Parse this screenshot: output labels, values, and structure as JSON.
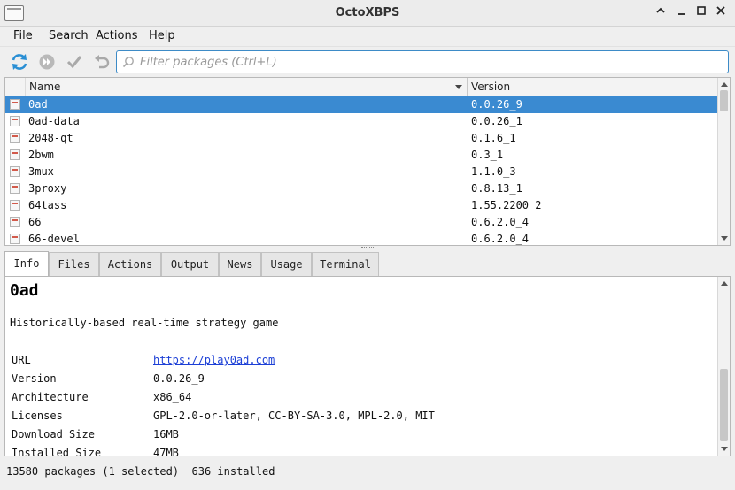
{
  "window": {
    "title": "OctoXBPS"
  },
  "menu": [
    {
      "label": "File"
    },
    {
      "label": "Search"
    },
    {
      "label": "Actions"
    },
    {
      "label": "Help"
    }
  ],
  "toolbar": {
    "icons": [
      "sync-icon",
      "run-icon",
      "commit-icon",
      "rollback-icon"
    ],
    "search_placeholder": "Filter packages (Ctrl+L)"
  },
  "table": {
    "columns": {
      "name": "Name",
      "version": "Version"
    },
    "rows": [
      {
        "name": "0ad",
        "version": "0.0.26_9",
        "selected": true
      },
      {
        "name": "0ad-data",
        "version": "0.0.26_1"
      },
      {
        "name": "2048-qt",
        "version": "0.1.6_1"
      },
      {
        "name": "2bwm",
        "version": "0.3_1"
      },
      {
        "name": "3mux",
        "version": "1.1.0_3"
      },
      {
        "name": "3proxy",
        "version": "0.8.13_1"
      },
      {
        "name": "64tass",
        "version": "1.55.2200_2"
      },
      {
        "name": "66",
        "version": "0.6.2.0_4"
      },
      {
        "name": "66-devel",
        "version": "0.6.2.0_4"
      }
    ]
  },
  "tabs": [
    {
      "label": "Info"
    },
    {
      "label": "Files"
    },
    {
      "label": "Actions"
    },
    {
      "label": "Output"
    },
    {
      "label": "News"
    },
    {
      "label": "Usage"
    },
    {
      "label": "Terminal"
    }
  ],
  "info": {
    "title": "0ad",
    "description": "Historically-based real-time strategy game",
    "properties": [
      {
        "key": "URL",
        "value": "https://play0ad.com",
        "link": true
      },
      {
        "key": "Version",
        "value": "0.0.26_9"
      },
      {
        "key": "Architecture",
        "value": "x86_64"
      },
      {
        "key": "Licenses",
        "value": "GPL-2.0-or-later, CC-BY-SA-3.0, MPL-2.0, MIT"
      },
      {
        "key": "Download Size",
        "value": "16MB"
      },
      {
        "key": "Installed Size",
        "value": "47MB"
      }
    ]
  },
  "status": {
    "text": "13580 packages (1 selected)  636 installed"
  }
}
